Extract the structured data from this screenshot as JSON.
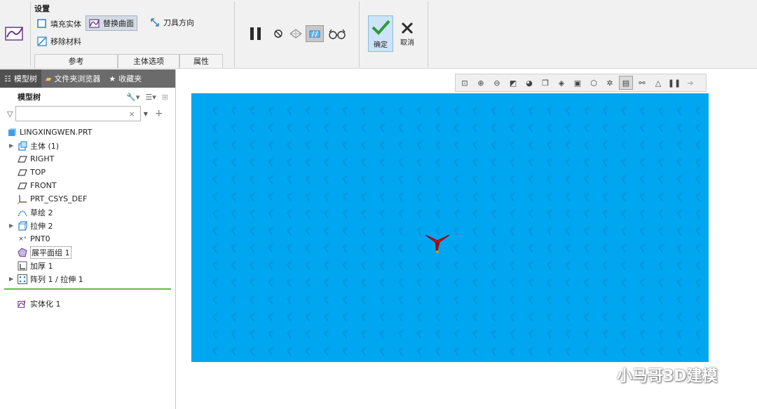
{
  "ribbon": {
    "settings_title": "设置",
    "options": {
      "fill_solid": "填充实体",
      "replace_surface": "替换曲面",
      "remove_material": "移除材料",
      "tool_direction": "刀具方向"
    },
    "tabs": [
      "参考",
      "主体选项",
      "属性"
    ],
    "ok_label": "确定",
    "cancel_label": "取消"
  },
  "left_panel": {
    "tabs": [
      "模型树",
      "文件夹浏览器",
      "收藏夹"
    ],
    "tree_header": "模型树",
    "filter_value": "",
    "tree_items": [
      {
        "label": "LINGXINGWEN.PRT",
        "icon": "part-icon",
        "expandable": false
      },
      {
        "label": "主体 (1)",
        "icon": "body-icon",
        "expandable": true
      },
      {
        "label": "RIGHT",
        "icon": "datum-plane-icon",
        "expandable": false
      },
      {
        "label": "TOP",
        "icon": "datum-plane-icon",
        "expandable": false
      },
      {
        "label": "FRONT",
        "icon": "datum-plane-icon",
        "expandable": false
      },
      {
        "label": "PRT_CSYS_DEF",
        "icon": "csys-icon",
        "expandable": false
      },
      {
        "label": "草绘 2",
        "icon": "sketch-icon",
        "expandable": false
      },
      {
        "label": "拉伸 2",
        "icon": "extrude-icon",
        "expandable": true
      },
      {
        "label": "PNT0",
        "icon": "datum-point-icon",
        "expandable": false
      },
      {
        "label": "展平面组 1",
        "icon": "flatten-quilt-icon",
        "expandable": false
      },
      {
        "label": "加厚 1",
        "icon": "thicken-icon",
        "expandable": false
      },
      {
        "label": "阵列 1 / 拉伸 1",
        "icon": "pattern-icon",
        "expandable": true
      }
    ],
    "active_feature": "实体化 1"
  },
  "watermark": "小马哥3D建模",
  "colors": {
    "model_blue": "#00a6f0",
    "insert_line": "#5cbf3a",
    "ok_check": "#2e9a3a"
  }
}
